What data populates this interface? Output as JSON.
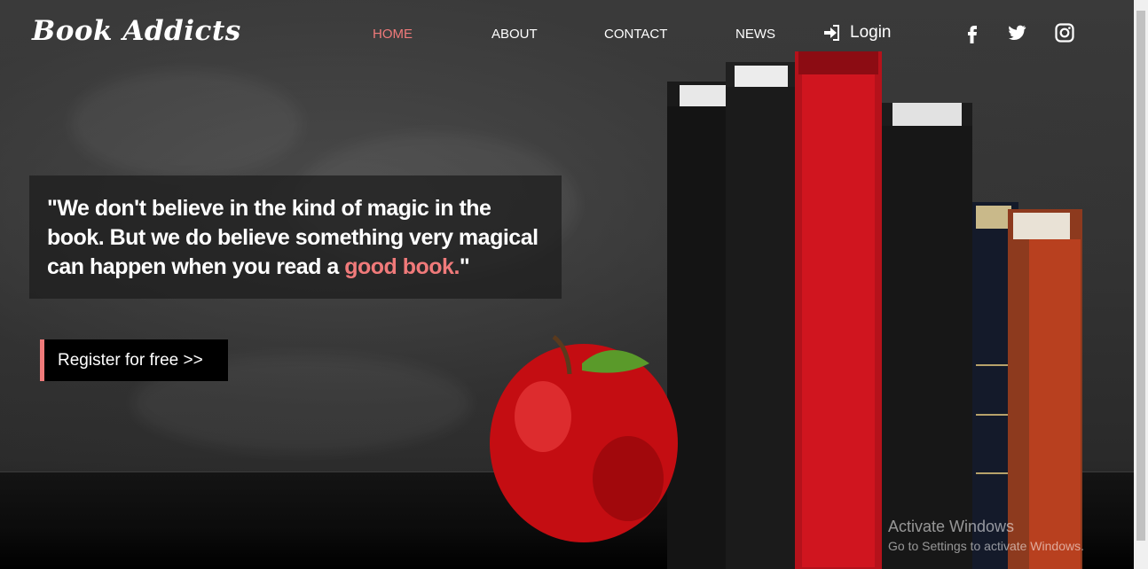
{
  "brand": {
    "logo": "Book Addicts"
  },
  "nav": {
    "items": [
      {
        "label": "HOME",
        "active": true
      },
      {
        "label": "ABOUT",
        "active": false
      },
      {
        "label": "CONTACT",
        "active": false
      },
      {
        "label": "NEWS",
        "active": false
      }
    ],
    "login": {
      "icon": "sign-in-icon",
      "label": "Login"
    },
    "social": [
      "facebook-icon",
      "twitter-icon",
      "instagram-icon"
    ]
  },
  "hero": {
    "quote_part1": "\"We don't believe in the kind of magic in the book. But we do believe something very magical can happen when you read a ",
    "quote_highlight": "good book.",
    "quote_end": "\"",
    "cta_label": "Register for free >>"
  },
  "colors": {
    "accent": "#f07a7a",
    "cta_bg": "#000000"
  },
  "os_watermark": {
    "line1": "Activate Windows",
    "line2": "Go to Settings to activate Windows."
  }
}
